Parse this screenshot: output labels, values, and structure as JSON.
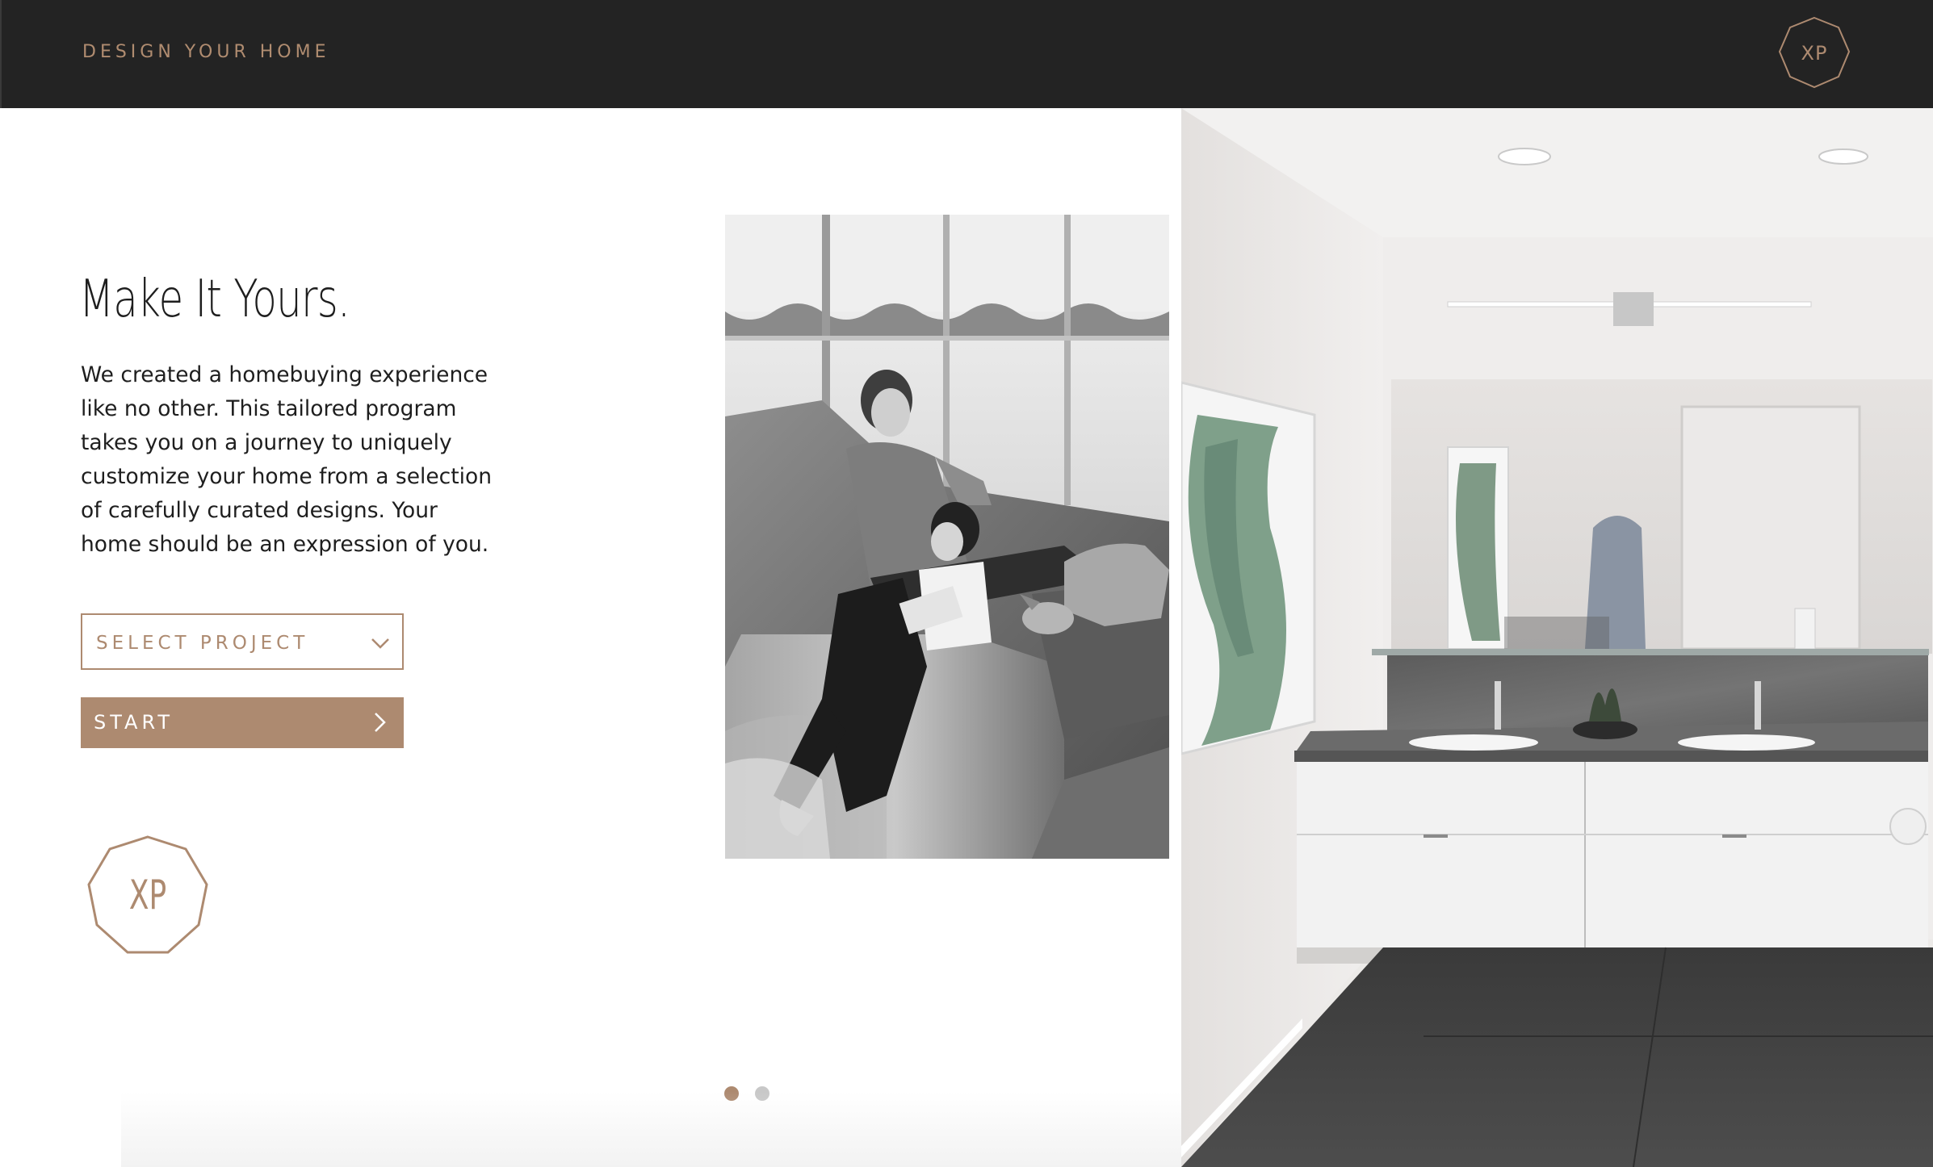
{
  "header": {
    "title": "DESIGN YOUR HOME",
    "logo_text": "XP"
  },
  "hero": {
    "headline": "Make It Yours.",
    "intro": "We created a homebuying experience like no other. This tailored program takes you on a journey to uniquely customize your home from a selection of carefully curated designs. Your home should be an expression of you."
  },
  "project_select": {
    "value": "SELECT PROJECT",
    "icon": "chevron-down-icon"
  },
  "start_button": {
    "label": "START",
    "icon": "chevron-right-icon"
  },
  "badge": {
    "text": "XP"
  },
  "carousel": {
    "slide_count": 2,
    "active_slide": 1
  },
  "colors": {
    "header_bg": "#232323",
    "accent": "#ad8a70",
    "body_text": "#1e1e1e",
    "inactive_dot": "#c8c8c8"
  }
}
